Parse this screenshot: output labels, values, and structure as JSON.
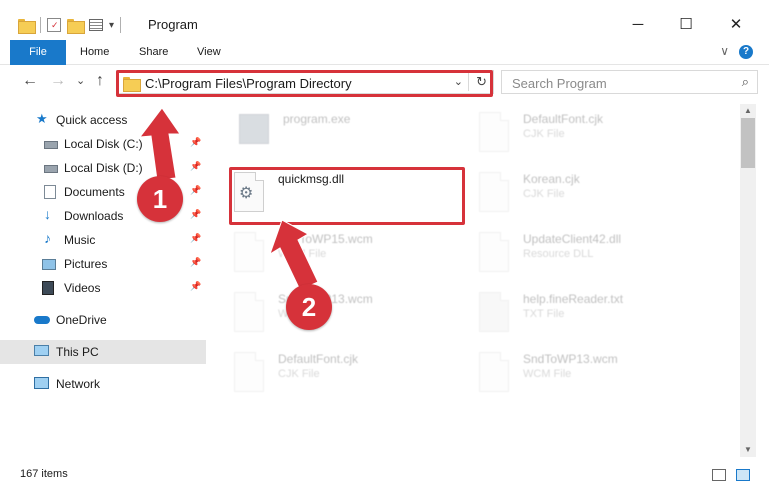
{
  "window": {
    "title": "Program",
    "minimize": "─",
    "maximize": "☐",
    "close": "✕"
  },
  "qat": {
    "dropdown": "▾"
  },
  "ribbon": {
    "tabs": [
      "File",
      "Home",
      "Share",
      "View"
    ],
    "collapse": "∨",
    "help": "?"
  },
  "nav": {
    "back": "←",
    "forward": "→",
    "recent": "⌄",
    "up": "↑"
  },
  "address": {
    "path": "C:\\Program Files\\Program Directory",
    "dropdown": "⌄",
    "refresh": "↻"
  },
  "search": {
    "placeholder": "Search Program",
    "icon": "⌕"
  },
  "sidebar": {
    "pin_glyph": "📌",
    "items": [
      {
        "label": "Quick access",
        "icon": "star-icon"
      },
      {
        "label": "Local Disk (C:)",
        "icon": "drive-icon"
      },
      {
        "label": "Local Disk (D:)",
        "icon": "drive-icon"
      },
      {
        "label": "Documents",
        "icon": "documents-icon"
      },
      {
        "label": "Downloads",
        "icon": "downloads-icon"
      },
      {
        "label": "Music",
        "icon": "music-icon"
      },
      {
        "label": "Pictures",
        "icon": "pictures-icon"
      },
      {
        "label": "Videos",
        "icon": "videos-icon"
      },
      {
        "label": "OneDrive",
        "icon": "cloud-icon"
      },
      {
        "label": "This PC",
        "icon": "computer-icon"
      },
      {
        "label": "Network",
        "icon": "network-icon"
      }
    ]
  },
  "files": [
    {
      "name": "program.exe",
      "type": ""
    },
    {
      "name": "DefaultFont.cjk",
      "type": "CJK File"
    },
    {
      "name": "quickmsg.dll",
      "type": ""
    },
    {
      "name": "Korean.cjk",
      "type": "CJK File"
    },
    {
      "name": "SndToWP15.wcm",
      "type": "WCM File"
    },
    {
      "name": "UpdateClient42.dll",
      "type": "Resource DLL"
    },
    {
      "name": "SndToWP13.wcm",
      "type": "WCM File"
    },
    {
      "name": "help.fineReader.txt",
      "type": "TXT File"
    },
    {
      "name": "DefaultFont.cjk",
      "type": "CJK File"
    },
    {
      "name": "SndToWP13.wcm",
      "type": "WCM File"
    }
  ],
  "callouts": [
    "1",
    "2"
  ],
  "status": {
    "item_count": "167 items"
  },
  "colors": {
    "accent": "#1979ca",
    "highlight": "#d6323a"
  }
}
